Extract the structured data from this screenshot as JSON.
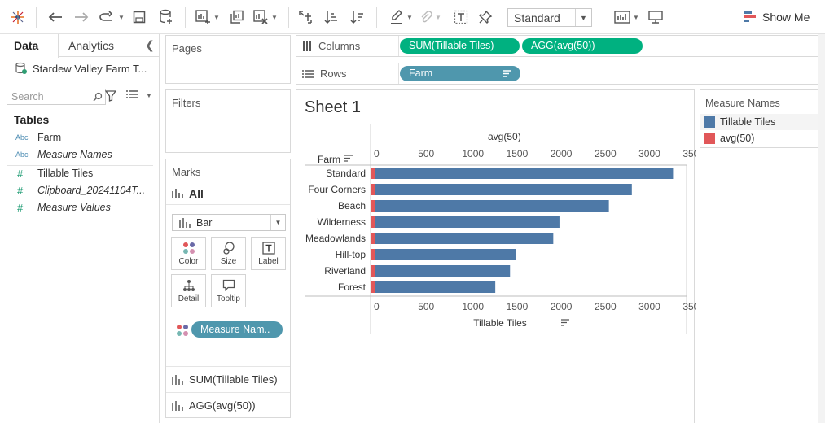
{
  "toolbar": {
    "fit_select": "Standard",
    "show_me_label": "Show Me"
  },
  "data_pane": {
    "tabs": [
      "Data",
      "Analytics"
    ],
    "datasource": "Stardew Valley Farm T...",
    "search_placeholder": "Search",
    "tables_heading": "Tables",
    "fields": [
      {
        "type": "Abc",
        "name": "Farm",
        "italic": false
      },
      {
        "type": "Abc",
        "name": "Measure Names",
        "italic": true
      },
      {
        "type": "#",
        "name": "Tillable Tiles",
        "italic": false
      },
      {
        "type": "#",
        "name": "Clipboard_20241104T...",
        "italic": true
      },
      {
        "type": "#",
        "name": "Measure Values",
        "italic": true
      }
    ]
  },
  "cards": {
    "pages": "Pages",
    "filters": "Filters",
    "marks": "Marks"
  },
  "marks": {
    "all_label": "All",
    "mark_type": "Bar",
    "buttons": [
      "Color",
      "Size",
      "Label",
      "Detail",
      "Tooltip"
    ],
    "color_pill": "Measure Nam..",
    "measures": [
      "SUM(Tillable Tiles)",
      "AGG(avg(50))"
    ]
  },
  "shelves": {
    "columns_label": "Columns",
    "rows_label": "Rows",
    "columns_pills": [
      "SUM(Tillable Tiles)",
      "AGG(avg(50))"
    ],
    "rows_pills": [
      "Farm"
    ]
  },
  "sheet": {
    "title": "Sheet 1"
  },
  "legend": {
    "title": "Measure Names",
    "items": [
      {
        "label": "Tillable Tiles",
        "color": "#4e79a7"
      },
      {
        "label": "avg(50)",
        "color": "#e15759"
      }
    ]
  },
  "chart_data": {
    "type": "bar",
    "orientation": "horizontal",
    "row_header": "Farm",
    "categories": [
      "Standard",
      "Four Corners",
      "Beach",
      "Wilderness",
      "Meadowlands",
      "Hill-top",
      "Riverland",
      "Forest"
    ],
    "series": [
      {
        "name": "Tillable Tiles",
        "values": [
          3427,
          2960,
          2700,
          2140,
          2070,
          1650,
          1580,
          1413
        ],
        "color": "#4e79a7"
      },
      {
        "name": "avg(50)",
        "values": [
          50,
          50,
          50,
          50,
          50,
          50,
          50,
          50
        ],
        "color": "#e15759"
      }
    ],
    "top_axis": {
      "label": "avg(50)",
      "ticks": [
        0,
        500,
        1000,
        1500,
        2000,
        2500,
        3000,
        3500
      ]
    },
    "bottom_axis": {
      "label": "Tillable Tiles",
      "ticks": [
        0,
        500,
        1000,
        1500,
        2000,
        2500,
        3000,
        3500
      ]
    },
    "xlim": [
      0,
      3580
    ],
    "grid": false
  }
}
